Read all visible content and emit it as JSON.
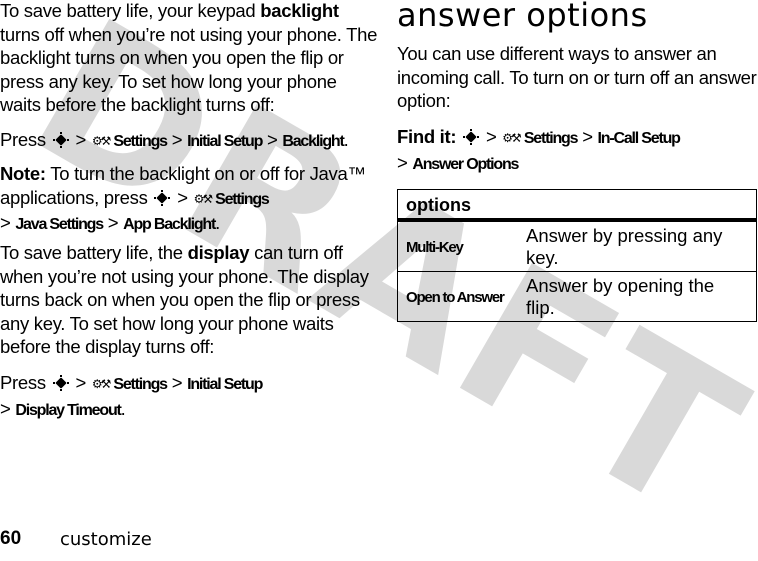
{
  "watermark": "DRAFT",
  "left": {
    "p1": {
      "pre": "To save battery life, your keypad ",
      "bold": "backlight",
      "post": " turns off when you’re not using your phone. The backlight turns on when you open the flip or press any key. To set how long your phone waits before the backlight turns off:"
    },
    "p2": {
      "press": "Press",
      "sep": ">",
      "settings": "Settings",
      "item1": "Initial Setup",
      "item2": "Backlight",
      "end": "."
    },
    "p3": {
      "note": "Note:",
      "text": " To turn the backlight on or off for Java™ applications, press",
      "sep": ">",
      "settings": "Settings",
      "item1": "Java Settings",
      "item2": "App Backlight",
      "end": "."
    },
    "p4": {
      "pre": "To save battery life, the ",
      "bold": "display",
      "post": " can turn off when you’re not using your phone. The display turns back on when you open the flip or press any key. To set how long your phone waits before the display turns off:"
    },
    "p5": {
      "press": "Press",
      "sep": ">",
      "settings": "Settings",
      "item1": "Initial Setup",
      "item2": "Display Timeout",
      "end": "."
    }
  },
  "right": {
    "heading": "answer options",
    "intro": "You can use different ways to answer an incoming call. To turn on or turn off an answer option:",
    "findit": {
      "label": "Find it:",
      "sep": ">",
      "settings": "Settings",
      "item1": "In-Call Setup",
      "item2": "Answer Options"
    },
    "table": {
      "header": "options",
      "rows": [
        {
          "option": "Multi-Key",
          "description": "Answer by pressing any key."
        },
        {
          "option": "Open to Answer",
          "description": "Answer by opening the flip."
        }
      ]
    }
  },
  "footer": {
    "page_number": "60",
    "section": "customize"
  },
  "icons": {
    "nav_key": "nav-key-icon",
    "settings": "settings-icon"
  },
  "colors": {
    "watermark": "#d9d9d9",
    "text": "#000000"
  }
}
